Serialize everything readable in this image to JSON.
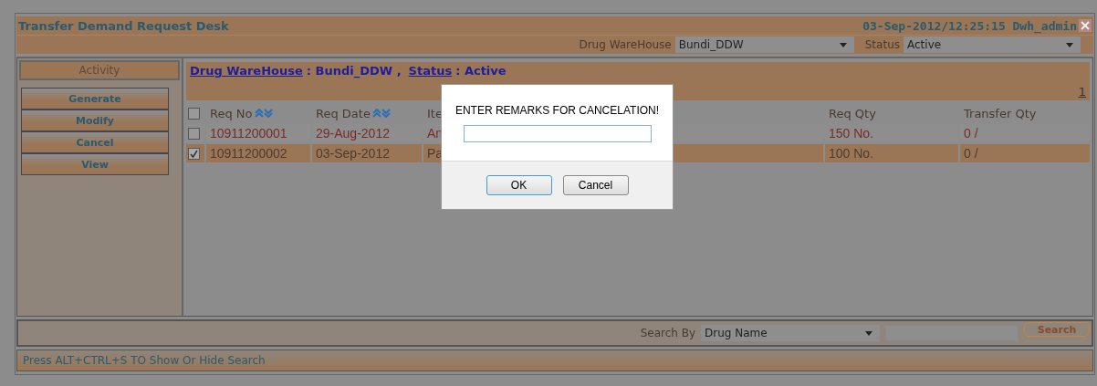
{
  "window": {
    "title": "Transfer Demand Request Desk",
    "datetime_user": "03-Sep-2012/12:25:15 Dwh_admin"
  },
  "filters": [
    {
      "label": "Drug WareHouse",
      "value": "Bundi_DDW"
    },
    {
      "label": "Status",
      "value": "Active"
    }
  ],
  "sidebar": {
    "heading": "Activity",
    "buttons": [
      "Generate",
      "Modify",
      "Cancel",
      "View"
    ]
  },
  "content": {
    "filter_summary": [
      {
        "label": "Drug WareHouse",
        "value": ": Bundi_DDW ,"
      },
      {
        "label": "Status",
        "value": ": Active"
      }
    ],
    "page": "1"
  },
  "table": {
    "select_all_checked": false,
    "columns": [
      {
        "label": "Req No",
        "sortable": true
      },
      {
        "label": "Req Date",
        "sortable": true
      },
      {
        "label": "Ite",
        "sortable": false
      },
      {
        "label": "Req Qty",
        "sortable": false
      },
      {
        "label": "Transfer Qty",
        "sortable": false
      }
    ],
    "rows": [
      {
        "selected": false,
        "cells": [
          "10911200001",
          "29-Aug-2012",
          "An",
          "150 No.",
          "0 /"
        ]
      },
      {
        "selected": true,
        "cells": [
          "10911200002",
          "03-Sep-2012",
          "Pa",
          "100 No.",
          "0 /"
        ]
      }
    ]
  },
  "search": {
    "label": "Search By",
    "field": "Drug Name",
    "button": "Search"
  },
  "status_bar": "Press ALT+CTRL+S TO Show Or Hide Search",
  "dialog": {
    "message": "ENTER REMARKS FOR CANCELATION!",
    "buttons": [
      "OK",
      "Cancel"
    ]
  }
}
